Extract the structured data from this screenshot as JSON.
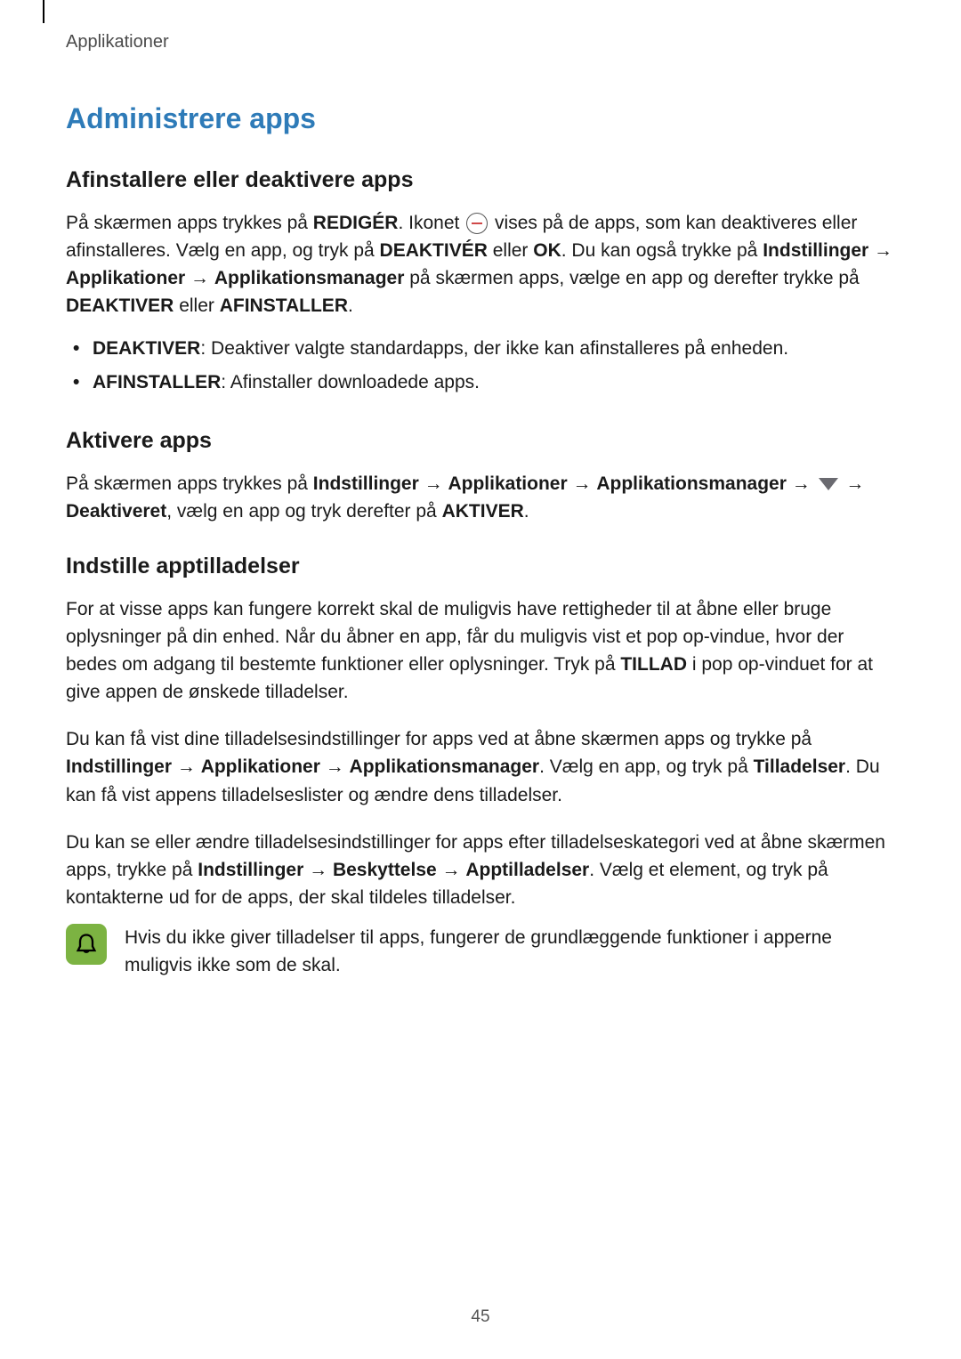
{
  "header": {
    "section_label": "Applikationer"
  },
  "heading": "Administrere apps",
  "s1": {
    "title": "Afinstallere eller deaktivere apps",
    "p1a": "På skærmen apps trykkes på ",
    "p1b": "REDIGÉR",
    "p1c": ". Ikonet ",
    "p1d": " vises på de apps, som kan deaktiveres eller afinstalleres. Vælg en app, og tryk på ",
    "p1e": "DEAKTIVÉR",
    "p1f": " eller ",
    "p1g": "OK",
    "p1h": ". Du kan også trykke på ",
    "p1i": "Indstillinger",
    "p1j": " → ",
    "p1k": "Applikationer",
    "p1l": " → ",
    "p1m": "Applikationsmanager",
    "p1n": " på skærmen apps, vælge en app og derefter trykke på ",
    "p1o": "DEAKTIVER",
    "p1p": " eller ",
    "p1q": "AFINSTALLER",
    "p1r": ".",
    "b1a": "DEAKTIVER",
    "b1b": ": Deaktiver valgte standardapps, der ikke kan afinstalleres på enheden.",
    "b2a": "AFINSTALLER",
    "b2b": ": Afinstaller downloadede apps."
  },
  "s2": {
    "title": "Aktivere apps",
    "p1a": "På skærmen apps trykkes på ",
    "p1b": "Indstillinger",
    "p1c": " → ",
    "p1d": "Applikationer",
    "p1e": " → ",
    "p1f": "Applikationsmanager",
    "p1g": " → ",
    "p1h": " → ",
    "p1i": "Deaktiveret",
    "p1j": ", vælg en app og tryk derefter på ",
    "p1k": "AKTIVER",
    "p1l": "."
  },
  "s3": {
    "title": "Indstille apptilladelser",
    "p1a": "For at visse apps kan fungere korrekt skal de muligvis have rettigheder til at åbne eller bruge oplysninger på din enhed. Når du åbner en app, får du muligvis vist et pop op-vindue, hvor der bedes om adgang til bestemte funktioner eller oplysninger. Tryk på ",
    "p1b": "TILLAD",
    "p1c": " i pop op-vinduet for at give appen de ønskede tilladelser.",
    "p2a": "Du kan få vist dine tilladelsesindstillinger for apps ved at åbne skærmen apps og trykke på ",
    "p2b": "Indstillinger",
    "p2c": " → ",
    "p2d": "Applikationer",
    "p2e": " → ",
    "p2f": "Applikationsmanager",
    "p2g": ". Vælg en app, og tryk på ",
    "p2h": "Tilladelser",
    "p2i": ". Du kan få vist appens tilladelseslister og ændre dens tilladelser.",
    "p3a": "Du kan se eller ændre tilladelsesindstillinger for apps efter tilladelseskategori ved at åbne skærmen apps, trykke på ",
    "p3b": "Indstillinger",
    "p3c": " → ",
    "p3d": "Beskyttelse",
    "p3e": " → ",
    "p3f": "Apptilladelser",
    "p3g": ". Vælg et element, og tryk på kontakterne ud for de apps, der skal tildeles tilladelser.",
    "note": "Hvis du ikke giver tilladelser til apps, fungerer de grundlæggende funktioner i apperne muligvis ikke som de skal."
  },
  "page_number": "45"
}
